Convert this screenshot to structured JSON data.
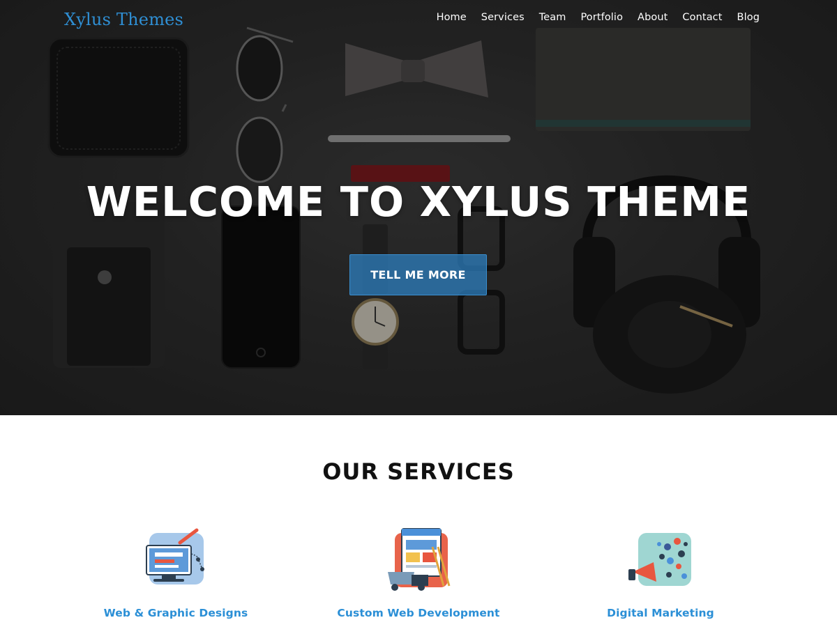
{
  "brand": {
    "name": "Xylus Themes"
  },
  "nav": {
    "items": [
      "Home",
      "Services",
      "Team",
      "Portfolio",
      "About",
      "Contact",
      "Blog"
    ]
  },
  "hero": {
    "title": "WELCOME TO XYLUS THEME",
    "button_label": "TELL ME MORE"
  },
  "services": {
    "title": "OUR SERVICES",
    "items": [
      {
        "label": "Web & Graphic Designs",
        "icon": "web-design-icon"
      },
      {
        "label": "Custom Web Development",
        "icon": "web-development-icon"
      },
      {
        "label": "Digital Marketing",
        "icon": "digital-marketing-icon"
      }
    ]
  },
  "colors": {
    "brand_blue": "#2f8fd4",
    "service_link_blue": "#2b8fd6",
    "hero_button": "#2e82c5",
    "hero_background": "#2f2f2f"
  }
}
